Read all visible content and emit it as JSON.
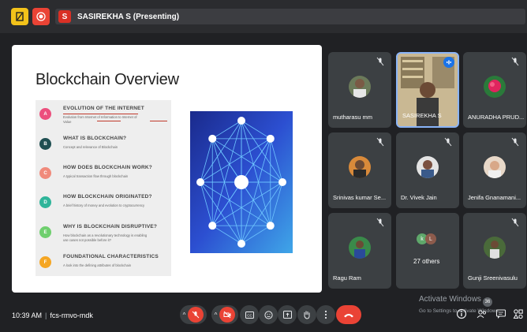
{
  "topbar": {
    "presenter_initial": "S",
    "presenter_label": "SASIREKHA S (Presenting)"
  },
  "slide": {
    "title": "Blockchain Overview",
    "agenda": [
      {
        "letter": "A",
        "color": "#ec4f7d",
        "title": "EVOLUTION OF THE INTERNET",
        "sub": "Evolution from Internet of Information to Internet of",
        "sub2": "Value"
      },
      {
        "letter": "B",
        "color": "#1f4f52",
        "title": "WHAT IS BLOCKCHAIN?",
        "sub": "Concept and relevance of Blockchain",
        "sub2": ""
      },
      {
        "letter": "C",
        "color": "#f08a7b",
        "title": "HOW DOES BLOCKCHAIN WORK?",
        "sub": "A typical transaction flow through blockchain",
        "sub2": ""
      },
      {
        "letter": "D",
        "color": "#2fb59a",
        "title": "HOW BLOCKCHAIN ORIGINATED?",
        "sub": "A brief history of money and evolution to cryptocurrency",
        "sub2": ""
      },
      {
        "letter": "E",
        "color": "#6fcf6e",
        "title": "WHY IS BLOCKCHAIN DISRUPTIVE?",
        "sub": "How blockchain as a revolutionary technology is enabling",
        "sub2": "use cases not possible before it?"
      },
      {
        "letter": "F",
        "color": "#f5a623",
        "title": "FOUNDATIONAL CHARACTERISTICS",
        "sub": "A look into the defining attributes of blockchain",
        "sub2": ""
      }
    ]
  },
  "participants": [
    {
      "name": "mutharasu mm"
    },
    {
      "name": "SASIREKHA S"
    },
    {
      "name": "ANURADHA PRUD..."
    },
    {
      "name": "Srinivas kumar Se..."
    },
    {
      "name": "Dr. Vivek Jain"
    },
    {
      "name": "Jenifa Gnanamani..."
    },
    {
      "name": "Ragu Ram"
    },
    {
      "name": "27 others",
      "initials": [
        "k",
        "L"
      ]
    },
    {
      "name": "Gunji Sreenivasulu"
    }
  ],
  "bottombar": {
    "time": "10:39 AM",
    "meeting_code": "fcs-rmvo-mdk",
    "badge": "36"
  },
  "watermark": {
    "line1": "Activate Windows",
    "line2": "Go to Settings to activate Windows."
  },
  "colors": {
    "accent_red": "#ea4335",
    "active_border": "#8ab4f8",
    "tile_bg": "#3c4043"
  }
}
